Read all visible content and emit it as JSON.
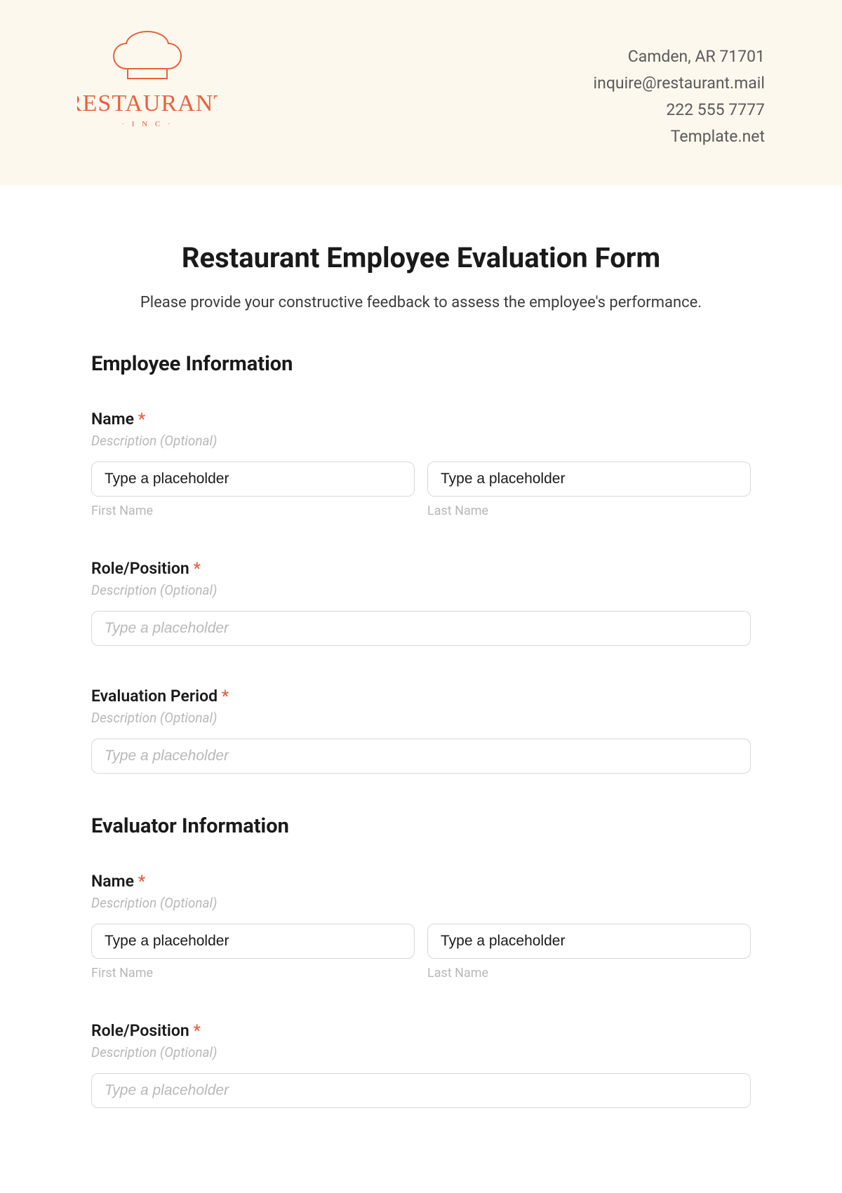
{
  "header": {
    "logo_line1": "RESTAURANT",
    "logo_line2": "· I N C ·",
    "contact": {
      "line1": "Camden, AR 71701",
      "line2": "inquire@restaurant.mail",
      "line3": "222 555 7777",
      "line4": "Template.net"
    }
  },
  "form": {
    "title": "Restaurant Employee Evaluation Form",
    "subtitle": "Please provide your constructive feedback to assess the employee's performance."
  },
  "common": {
    "placeholder_text": "Type a placeholder",
    "placeholder_italic": "Type a placeholder",
    "desc_optional": "Description (Optional)",
    "first_name": "First Name",
    "last_name": "Last Name",
    "required_mark": "*"
  },
  "sections": {
    "employee": {
      "heading": "Employee Information",
      "name_label": "Name",
      "role_label": "Role/Position",
      "period_label": "Evaluation Period"
    },
    "evaluator": {
      "heading": "Evaluator Information",
      "name_label": "Name",
      "role_label": "Role/Position"
    }
  }
}
